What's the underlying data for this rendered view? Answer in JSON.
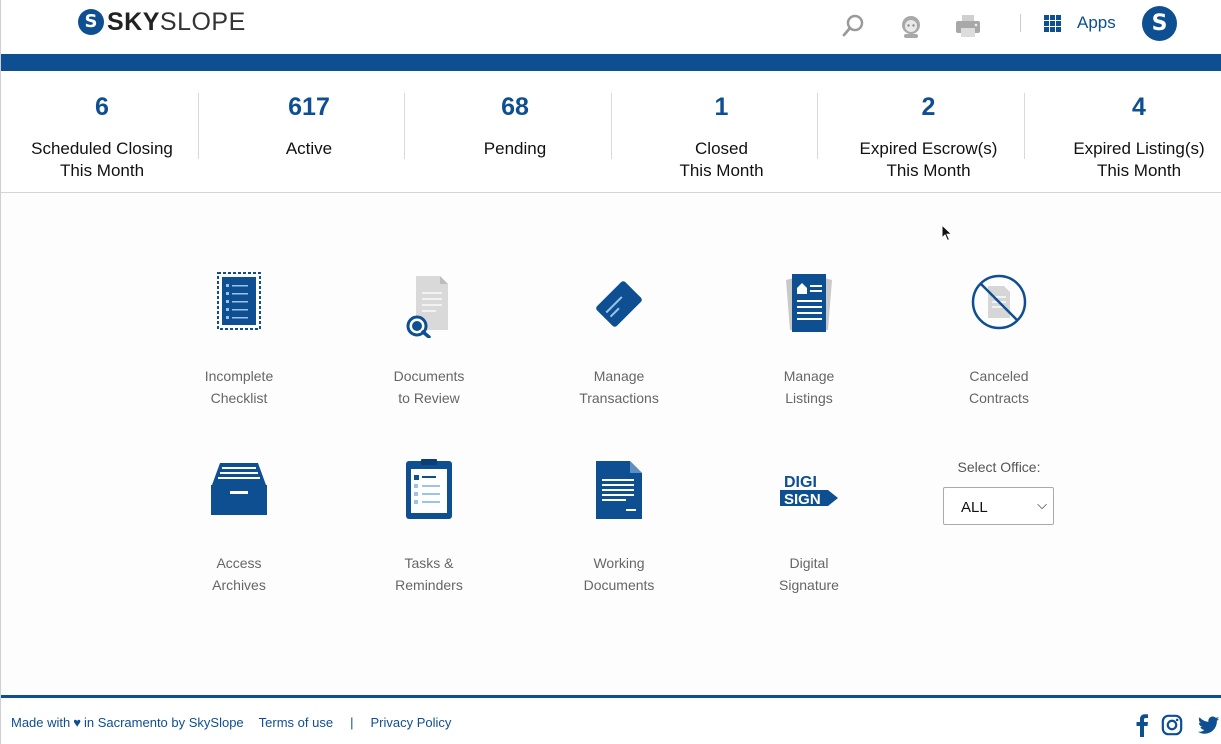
{
  "header": {
    "logo_bold": "SKY",
    "logo_rest": "SLOPE",
    "apps_label": "Apps",
    "avatar_initial": "S"
  },
  "stats": [
    {
      "value": "6",
      "label_line1": "Scheduled Closing",
      "label_line2": "This Month"
    },
    {
      "value": "617",
      "label_line1": "Active",
      "label_line2": ""
    },
    {
      "value": "68",
      "label_line1": "Pending",
      "label_line2": ""
    },
    {
      "value": "1",
      "label_line1": "Closed",
      "label_line2": "This Month"
    },
    {
      "value": "2",
      "label_line1": "Expired Escrow(s)",
      "label_line2": "This Month"
    },
    {
      "value": "4",
      "label_line1": "Expired Listing(s)",
      "label_line2": "This Month"
    }
  ],
  "tiles": [
    {
      "line1": "Incomplete",
      "line2": "Checklist",
      "icon": "checklist-icon"
    },
    {
      "line1": "Documents",
      "line2": "to Review",
      "icon": "document-review-icon"
    },
    {
      "line1": "Manage",
      "line2": "Transactions",
      "icon": "transactions-card-icon"
    },
    {
      "line1": "Manage",
      "line2": "Listings",
      "icon": "listings-icon"
    },
    {
      "line1": "Canceled",
      "line2": "Contracts",
      "icon": "canceled-document-icon"
    },
    {
      "line1": "Access",
      "line2": "Archives",
      "icon": "archive-drawer-icon"
    },
    {
      "line1": "Tasks &",
      "line2": "Reminders",
      "icon": "clipboard-icon"
    },
    {
      "line1": "Working",
      "line2": "Documents",
      "icon": "working-document-icon"
    },
    {
      "line1": "Digital",
      "line2": "Signature",
      "icon": "digisign-icon",
      "icon_text_1": "DIGI",
      "icon_text_2": "SIGN"
    }
  ],
  "office": {
    "label": "Select Office:",
    "selected": "ALL"
  },
  "footer": {
    "made_with_prefix": "Made with",
    "made_with_suffix": "in Sacramento by SkySlope",
    "terms": "Terms of use",
    "separator": "|",
    "privacy": "Privacy Policy"
  },
  "colors": {
    "brand": "#0e4f92",
    "muted_text": "#666666"
  }
}
